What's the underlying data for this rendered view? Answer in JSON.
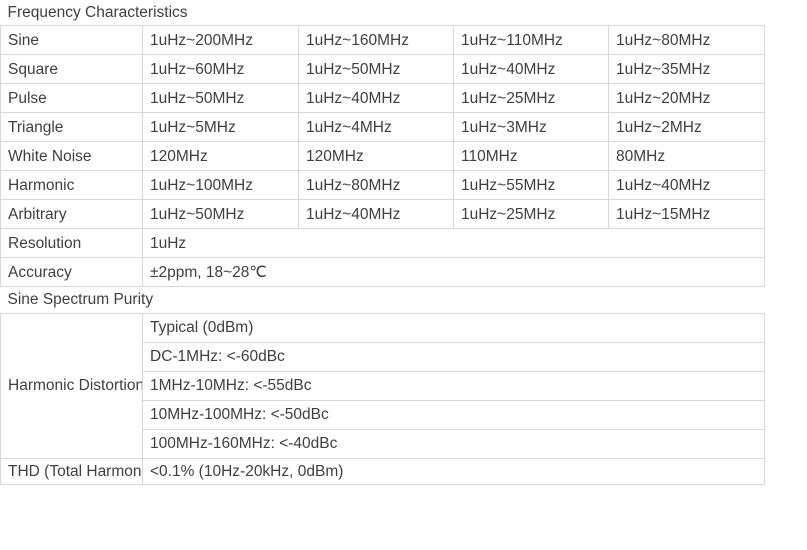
{
  "document": {
    "title": "Frequency Characteristics"
  },
  "sections": [
    {
      "heading": "Frequency Characteristics",
      "rows": [
        {
          "label": "Sine",
          "values": [
            "1uHz~200MHz",
            "1uHz~160MHz",
            "1uHz~110MHz",
            "1uHz~80MHz"
          ]
        },
        {
          "label": "Square",
          "values": [
            "1uHz~60MHz",
            "1uHz~50MHz",
            "1uHz~40MHz",
            "1uHz~35MHz"
          ]
        },
        {
          "label": "Pulse",
          "values": [
            "1uHz~50MHz",
            "1uHz~40MHz",
            "1uHz~25MHz",
            "1uHz~20MHz"
          ]
        },
        {
          "label": "Triangle",
          "values": [
            "1uHz~5MHz",
            "1uHz~4MHz",
            "1uHz~3MHz",
            "1uHz~2MHz"
          ]
        },
        {
          "label": "White Noise",
          "values": [
            "120MHz",
            "120MHz",
            "110MHz",
            "80MHz"
          ]
        },
        {
          "label": "Harmonic",
          "values": [
            "1uHz~100MHz",
            "1uHz~80MHz",
            "1uHz~55MHz",
            "1uHz~40MHz"
          ]
        },
        {
          "label": "Arbitrary",
          "values": [
            "1uHz~50MHz",
            "1uHz~40MHz",
            "1uHz~25MHz",
            "1uHz~15MHz"
          ]
        }
      ],
      "span_rows": [
        {
          "label": "Resolution",
          "value": "1uHz"
        },
        {
          "label": "Accuracy",
          "value": "±2ppm, 18~28℃"
        }
      ]
    },
    {
      "heading": "Sine Spectrum Purity",
      "harmonic_distortion": {
        "label": "Harmonic Distortion",
        "entries": [
          "Typical (0dBm)",
          "DC-1MHz: <-60dBc",
          "1MHz-10MHz: <-55dBc",
          "10MHz-100MHz: <-50dBc",
          "100MHz-160MHz: <-40dBc"
        ]
      },
      "thd": {
        "label": "THD (Total Harmonic Distortion)",
        "value": "<0.1% (10Hz-20kHz, 0dBm)"
      }
    }
  ],
  "style": {
    "text_color": "#404040",
    "border_color": "#d8d8d8",
    "background": "#ffffff"
  }
}
